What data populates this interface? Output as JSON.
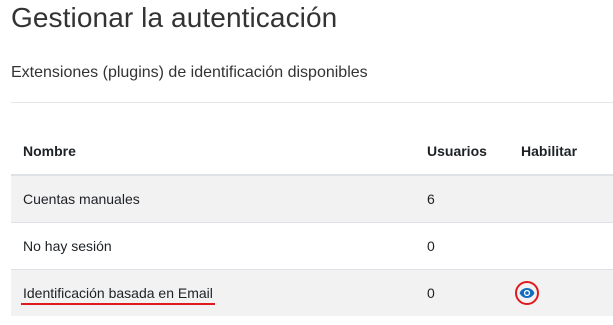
{
  "page": {
    "title": "Gestionar la autenticación",
    "section_title": "Extensiones (plugins) de identificación disponibles"
  },
  "table": {
    "headers": {
      "name": "Nombre",
      "users": "Usuarios",
      "enable": "Habilitar"
    },
    "rows": [
      {
        "name": "Cuentas manuales",
        "users": "6",
        "enable_icon": null
      },
      {
        "name": "No hay sesión",
        "users": "0",
        "enable_icon": null
      },
      {
        "name": "Identificación basada en Email",
        "users": "0",
        "enable_icon": "eye-icon",
        "highlighted": true
      }
    ]
  },
  "colors": {
    "highlight": "#e0191e",
    "link": "#1d2125",
    "icon": "#0f6cbf"
  }
}
